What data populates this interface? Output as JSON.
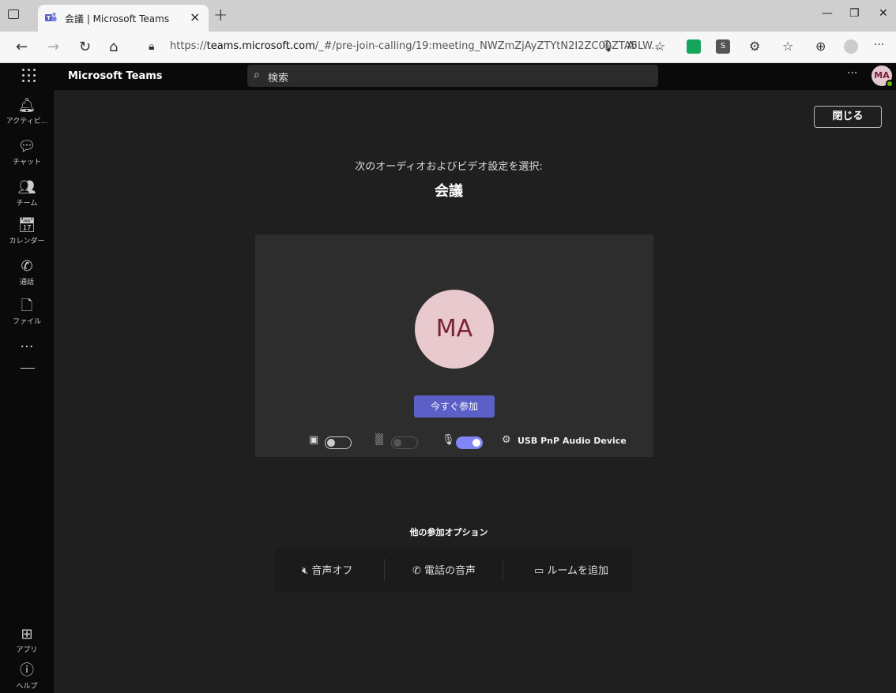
{
  "browser": {
    "tab_title": "会議 | Microsoft Teams",
    "url_prefix": "https://",
    "url_domain": "teams.microsoft.com",
    "url_rest": "/_#/pre-join-calling/19:meeting_NWZmZjAyZTYtN2I2ZC00ZTA5LW...",
    "colors": {
      "tabbar": "#cfcfcf",
      "toolbar": "#f7f7f7"
    }
  },
  "teams": {
    "app_name": "Microsoft Teams",
    "search_placeholder": "検索",
    "user_initials": "MA",
    "presence": "available"
  },
  "rail": {
    "items": [
      {
        "icon": "bell-icon",
        "label": "アクティビ..."
      },
      {
        "icon": "chat-icon",
        "label": "チャット"
      },
      {
        "icon": "teams-icon",
        "label": "チーム"
      },
      {
        "icon": "calendar-icon",
        "label": "カレンダー"
      },
      {
        "icon": "phone-icon",
        "label": "通話"
      },
      {
        "icon": "file-icon",
        "label": "ファイル"
      }
    ],
    "more": "···",
    "apps_label": "アプリ",
    "help_label": "ヘルプ"
  },
  "prejoin": {
    "close_label": "閉じる",
    "subtitle": "次のオーディオおよびビデオ設定を選択:",
    "title": "会議",
    "avatar_initials": "MA",
    "join_label": "今すぐ参加",
    "camera_on": false,
    "blur_on": false,
    "mic_on": true,
    "device_label": "USB PnP Audio Device",
    "accent": "#5b5fc7"
  },
  "other_options": {
    "heading": "他の参加オプション",
    "audio_off": "音声オフ",
    "phone_audio": "電話の音声",
    "add_room": "ルームを追加"
  }
}
